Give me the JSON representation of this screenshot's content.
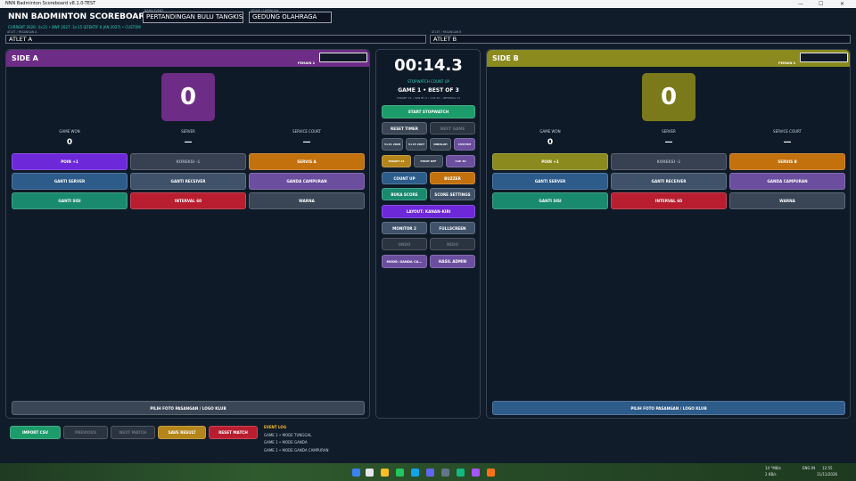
{
  "window": {
    "title": "NNN Badminton Scoreboard v8.1.0-TEST",
    "minimize": "—",
    "maximize": "☐",
    "close": "✕"
  },
  "header": {
    "app_title": "NNN BADMINTON SCOREBOARD",
    "sub_info": "CURRENT 2026: 3×21 • BWF 2027: 3×15 (EFEKTIF 6 JAN 2027) • CUSTOM",
    "event_label": "NAMA EVENT",
    "event_value": "PERTANDINGAN BULU TANGKIS",
    "venue_label": "VENUE / LAPANGAN",
    "venue_value": "GEDUNG OLAHRAGA",
    "athlete_a_label": "ATLET / PASANGAN A",
    "athlete_a": "ATLET A",
    "athlete_b_label": "ATLET / PASANGAN B",
    "athlete_b": "ATLET B"
  },
  "side_a": {
    "title": "SIDE A",
    "pemain_label": "PEMAIN 2",
    "score": "0",
    "game_won_label": "GAME WON",
    "game_won": "0",
    "server_label": "SERVER",
    "server": "—",
    "service_court_label": "SERVICE COURT",
    "service_court": "—",
    "buttons": {
      "poin": "POIN +1",
      "koreksi": "KOREKSI -1",
      "servis": "SERVIS A",
      "ganti_server": "GANTI SERVER",
      "ganti_receiver": "GANTI RECEIVER",
      "ganda_campuran": "GANDA CAMPURAN",
      "ganti_sisi": "GANTI SISI",
      "interval": "INTERVAL 60",
      "warna": "WARNA",
      "pilih_foto": "PILIH FOTO PASANGAN / LOGO KLUB"
    }
  },
  "side_b": {
    "title": "SIDE B",
    "pemain_label": "PEMAIN 2",
    "score": "0",
    "game_won_label": "GAME WON",
    "game_won": "0",
    "server_label": "SERVER",
    "server": "—",
    "service_court_label": "SERVICE COURT",
    "service_court": "—",
    "buttons": {
      "poin": "POIN +1",
      "koreksi": "KOREKSI -1",
      "servis": "SERVIS B",
      "ganti_server": "GANTI SERVER",
      "ganti_receiver": "GANTI RECEIVER",
      "ganda_campuran": "GANDA CAMPURAN",
      "ganti_sisi": "GANTI SISI",
      "interval": "INTERVAL 60",
      "warna": "WARNA",
      "pilih_foto": "PILIH FOTO PASANGAN / LOGO KLUB"
    }
  },
  "center": {
    "timer": "00:14.3",
    "stopwatch_mode": "STOPWATCH COUNT UP",
    "game_info": "GAME 1 • BEST OF 3",
    "target_info": "TARGET 21 • WIN BY 2 • CAP 30 • INTERVAL 11",
    "buttons": {
      "start_stopwatch": "START STOPWATCH",
      "reset_timer": "RESET TIMER",
      "next_game": "NEXT GAME",
      "preset1": "3×21 2026",
      "preset2": "3×15 2027",
      "preset3": "INDOLAH",
      "custom": "CUSTOM",
      "target": "TARGET 21",
      "point_ref": "POINT REF",
      "cap": "CAP 30",
      "count_up": "COUNT UP",
      "buzzer": "BUZZER",
      "buka_score": "BUKA SCORE",
      "score_settings": "SCORE SETTINGS",
      "layout": "LAYOUT: KANAN–KIRI",
      "monitor": "MONITOR 2",
      "fullscreen": "FULLSCREEN",
      "undo": "UNDO",
      "redo": "REDO",
      "mode": "MODE: GANDA CA...",
      "hasil_admin": "HASIL ADMIN"
    }
  },
  "footer": {
    "import_csv": "IMPORT CSV",
    "previous": "PREVIOUS",
    "next_match": "NEXT MATCH",
    "save_result": "SAVE RESULT",
    "reset_match": "RESET MATCH",
    "event_log_title": "EVENT LOG",
    "event_log": [
      "GAME 1 • MODE TUNGGAL",
      "GAME 1 • MODE GANDA",
      "GAME 1 • MODE GANDA CAMPURAN"
    ]
  },
  "taskbar": {
    "weather_line1": "14 °MB/s",
    "weather_line2": "2 KB/s",
    "lang": "ENG IN",
    "time": "12:55",
    "date": "11/11/2026"
  },
  "colors": {
    "side_a": "#6d2d86",
    "side_b": "#8a8a1f",
    "accent_teal": "#2dd4bf"
  }
}
